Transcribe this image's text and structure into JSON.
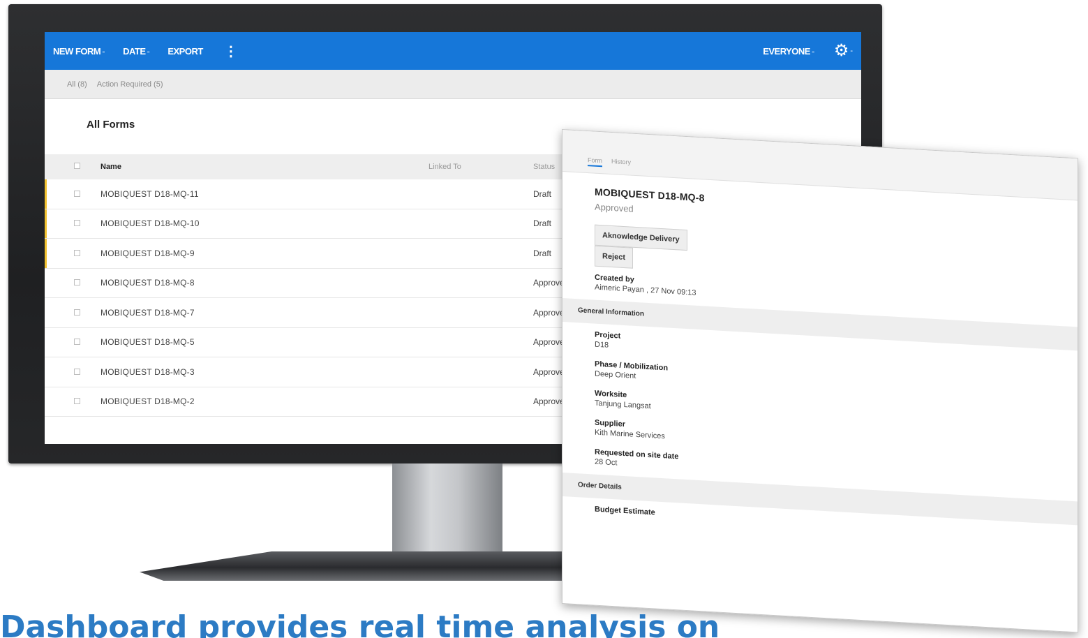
{
  "toolbar": {
    "new_form": "NEW FORM",
    "date": "DATE",
    "export": "EXPORT",
    "more_icon": "more-vertical-icon",
    "everyone": "EVERYONE",
    "caret": "-",
    "settings_icon": "gear-icon"
  },
  "filters": {
    "all": "All (8)",
    "action_required": "Action Required (5)"
  },
  "page": {
    "title": "All Forms"
  },
  "table": {
    "columns": {
      "name": "Name",
      "linked_to": "Linked To",
      "status": "Status"
    },
    "rows": [
      {
        "name": "MOBIQUEST D18-MQ-11",
        "status": "Draft"
      },
      {
        "name": "MOBIQUEST D18-MQ-10",
        "status": "Draft"
      },
      {
        "name": "MOBIQUEST D18-MQ-9",
        "status": "Draft"
      },
      {
        "name": "MOBIQUEST D18-MQ-8",
        "status": "Approved"
      },
      {
        "name": "MOBIQUEST D18-MQ-7",
        "status": "Approved"
      },
      {
        "name": "MOBIQUEST D18-MQ-5",
        "status": "Approved"
      },
      {
        "name": "MOBIQUEST D18-MQ-3",
        "status": "Approved"
      },
      {
        "name": "MOBIQUEST D18-MQ-2",
        "status": "Approved"
      }
    ]
  },
  "detail": {
    "tabs": {
      "form": "Form",
      "history": "History"
    },
    "title": "MOBIQUEST D18-MQ-8",
    "status": "Approved",
    "acknowledge_label": "Aknowledge Delivery",
    "reject_label": "Reject",
    "created_by_label": "Created by",
    "created_by_value": "Aimeric Payan , 27 Nov 09:13",
    "general_section": "General Information",
    "project_label": "Project",
    "project_value": "D18",
    "phase_label": "Phase / Mobilization",
    "phase_value": "Deep Orient",
    "worksite_label": "Worksite",
    "worksite_value": "Tanjung Langsat",
    "supplier_label": "Supplier",
    "supplier_value": "Kith Marine Services",
    "requested_label": "Requested on site date",
    "requested_value": "28 Oct",
    "order_section": "Order Details",
    "budget_label": "Budget Estimate"
  },
  "caption": "Dashboard provides real time analysis on",
  "colors": {
    "accent": "#1677d9",
    "draft_flag": "#f2c230",
    "caption": "#2c7bc4"
  }
}
